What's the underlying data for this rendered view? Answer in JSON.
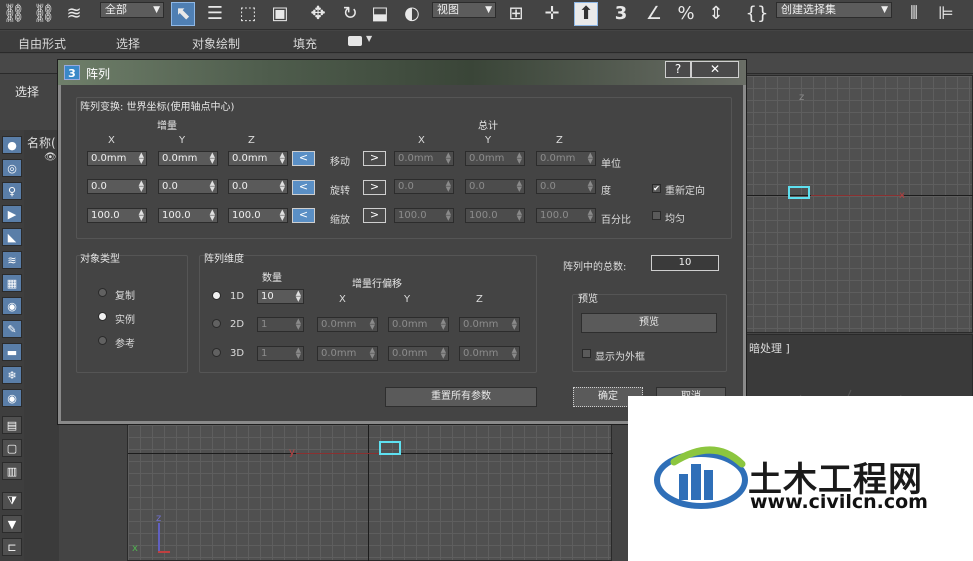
{
  "toolbar": {
    "filter_dropdown": "全部",
    "view_dropdown": "视图",
    "selection_set_dropdown": "创建选择集"
  },
  "ribbon": {
    "tabs": [
      "自由形式",
      "选择",
      "对象绘制",
      "填充"
    ]
  },
  "left_panel": {
    "select_label": "选择",
    "name_column": "名称("
  },
  "viewport_bottom": {
    "axis_y": "y",
    "axis_z": "z",
    "axis_x": "x"
  },
  "viewport_right": {
    "label_fragment": "暗处理 ]",
    "axis_x": "x",
    "axis_z": "z"
  },
  "dialog": {
    "app_icon": "3",
    "title": "阵列",
    "help": "?",
    "close": "✕",
    "transform_group_label": "阵列变换: 世界坐标(使用轴点中心)",
    "increment_header": "增量",
    "total_header": "总计",
    "axes": [
      "X",
      "Y",
      "Z"
    ],
    "rows": [
      {
        "label": "移动",
        "increment": [
          "0.0mm",
          "0.0mm",
          "0.0mm"
        ],
        "total": [
          "0.0mm",
          "0.0mm",
          "0.0mm"
        ],
        "unit": "单位",
        "left_arrow": "<",
        "right_arrow": ">"
      },
      {
        "label": "旋转",
        "increment": [
          "0.0",
          "0.0",
          "0.0"
        ],
        "total": [
          "0.0",
          "0.0",
          "0.0"
        ],
        "unit": "度",
        "left_arrow": "<",
        "right_arrow": ">"
      },
      {
        "label": "缩放",
        "increment": [
          "100.0",
          "100.0",
          "100.0"
        ],
        "total": [
          "100.0",
          "100.0",
          "100.0"
        ],
        "unit": "百分比",
        "left_arrow": "<",
        "right_arrow": ">"
      }
    ],
    "reorient_label": "重新定向",
    "reorient_checked": true,
    "uniform_label": "均匀",
    "uniform_checked": false,
    "object_type": {
      "label": "对象类型",
      "options": [
        "复制",
        "实例",
        "参考"
      ],
      "selected_index": 1
    },
    "dimensions": {
      "label": "阵列维度",
      "count_header": "数量",
      "offset_header": "增量行偏移",
      "axes": [
        "X",
        "Y",
        "Z"
      ],
      "rows": [
        {
          "label": "1D",
          "count": "10",
          "offsets": [],
          "selected": true
        },
        {
          "label": "2D",
          "count": "1",
          "offsets": [
            "0.0mm",
            "0.0mm",
            "0.0mm"
          ],
          "selected": false
        },
        {
          "label": "3D",
          "count": "1",
          "offsets": [
            "0.0mm",
            "0.0mm",
            "0.0mm"
          ],
          "selected": false
        }
      ]
    },
    "total_in_array_label": "阵列中的总数:",
    "total_in_array_value": "10",
    "preview": {
      "label": "预览",
      "button": "预览",
      "show_as_box_label": "显示为外框",
      "show_as_box_checked": false
    },
    "reset_button": "重置所有参数",
    "ok_button": "确定",
    "cancel_button": "取消"
  },
  "watermark": {
    "title": "土木工程网",
    "url": "www.civilcn.com"
  }
}
